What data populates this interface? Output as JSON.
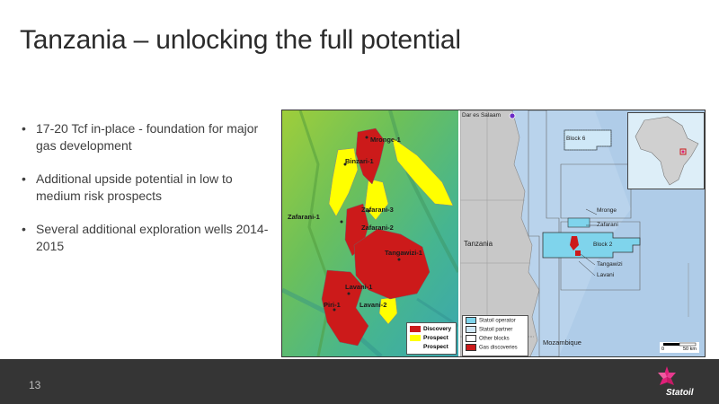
{
  "slide": {
    "title": "Tanzania – unlocking the full potential",
    "bullets": [
      "17-20 Tcf in-place - foundation for major gas development",
      "Additional upside potential in low to medium risk prospects",
      "Several additional exploration wells 2014-2015"
    ],
    "bullet_symbol": "•",
    "page_number": "13"
  },
  "map_left": {
    "labels": {
      "mronge": "Mronge-1",
      "binzari": "Binzari-1",
      "zafarani3": "Zafarani-3",
      "zafarani1": "Zafarani-1",
      "zafarani2": "Zafarani-2",
      "tangawizi": "Tangawizi-1",
      "lavani1": "Lavani-1",
      "piri": "Piri-1",
      "lavani2": "Lavani-2"
    },
    "legend": {
      "discovery": "Discovery",
      "prospect1": "Prospect",
      "prospect2": "Prospect"
    }
  },
  "map_right": {
    "labels": {
      "dar_es_salaam": "Dar es Salaam",
      "block6": "Block 6",
      "tanzania": "Tanzania",
      "mronge": "Mronge",
      "zafarani": "Zafarani",
      "block2": "Block 2",
      "tangawizi": "Tangawizi",
      "lavani": "Lavani",
      "mozambique": "Mozambique"
    },
    "legend": {
      "operator": "Statoil operator",
      "partner": "Statoil partner",
      "other": "Other blocks",
      "gas": "Gas discoveries"
    },
    "scale": {
      "zero": "0",
      "fifty": "50 km"
    }
  },
  "brand": {
    "name": "Statoil"
  },
  "colors": {
    "footer": "#353535",
    "discovery": "#cc1a1a",
    "prospect": "#ffff00",
    "operator_block": "#7fd4ec",
    "land": "#c8c8c8"
  }
}
